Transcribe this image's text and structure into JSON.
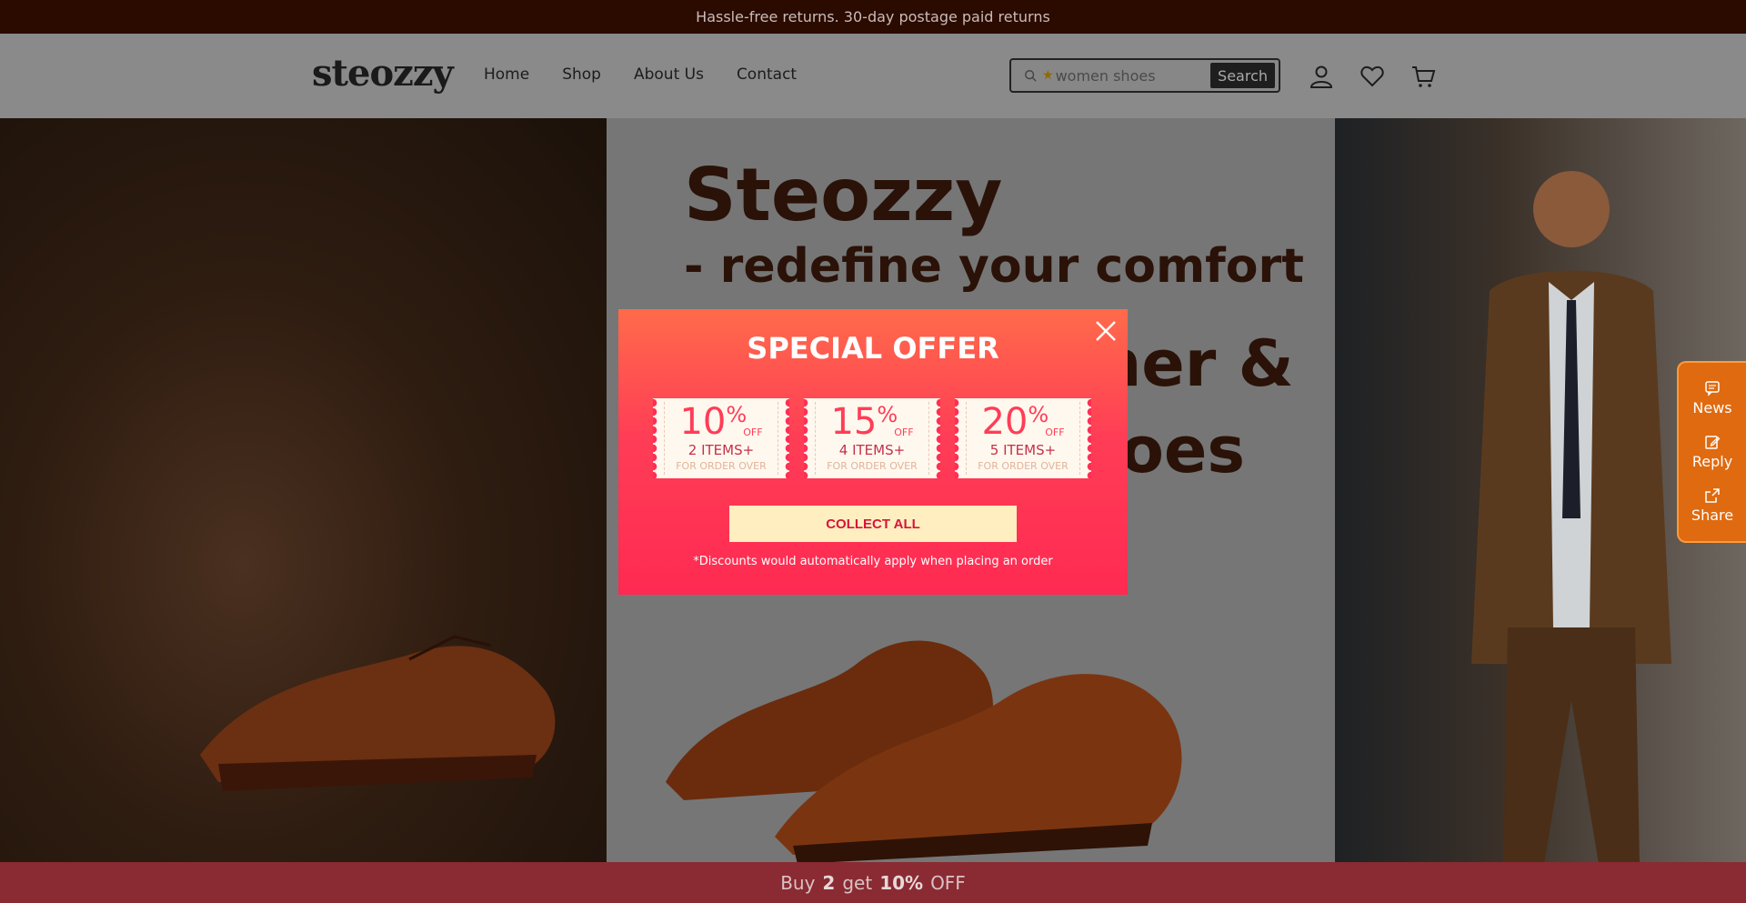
{
  "announcement": "Hassle-free returns. 30-day postage paid returns",
  "header": {
    "logo": "steozzy",
    "nav": [
      "Home",
      "Shop",
      "About Us",
      "Contact"
    ],
    "search": {
      "placeholder": "women shoes",
      "button": "Search"
    },
    "icons": [
      "account-icon",
      "wishlist-icon",
      "cart-icon"
    ]
  },
  "hero": {
    "line1": "Steozzy",
    "line2": "- redefine your comfort",
    "line3": "ther &",
    "line4": "hoes"
  },
  "side_tools": [
    {
      "label": "News",
      "icon": "chat-icon"
    },
    {
      "label": "Reply",
      "icon": "edit-icon"
    },
    {
      "label": "Share",
      "icon": "share-icon"
    }
  ],
  "modal": {
    "title": "SPECIAL OFFER",
    "coupons": [
      {
        "percent": "10",
        "symbol": "%",
        "off": "OFF",
        "items": "2 ITEMS+",
        "subtitle": "FOR ORDER OVER"
      },
      {
        "percent": "15",
        "symbol": "%",
        "off": "OFF",
        "items": "4 ITEMS+",
        "subtitle": "FOR ORDER OVER"
      },
      {
        "percent": "20",
        "symbol": "%",
        "off": "OFF",
        "items": "5 ITEMS+",
        "subtitle": "FOR ORDER OVER"
      }
    ],
    "collect_button": "COLLECT ALL",
    "note": "*Discounts would automatically apply when placing an order"
  },
  "bottom_bar": {
    "prefix": "Buy",
    "qty": "2",
    "mid": "get",
    "discount": "10%",
    "suffix": "OFF"
  },
  "colors": {
    "accent": "#ff3d56",
    "announce_bg": "#2b0a00",
    "tools_bg": "#e06a10",
    "button_bg": "#ffefc0"
  }
}
